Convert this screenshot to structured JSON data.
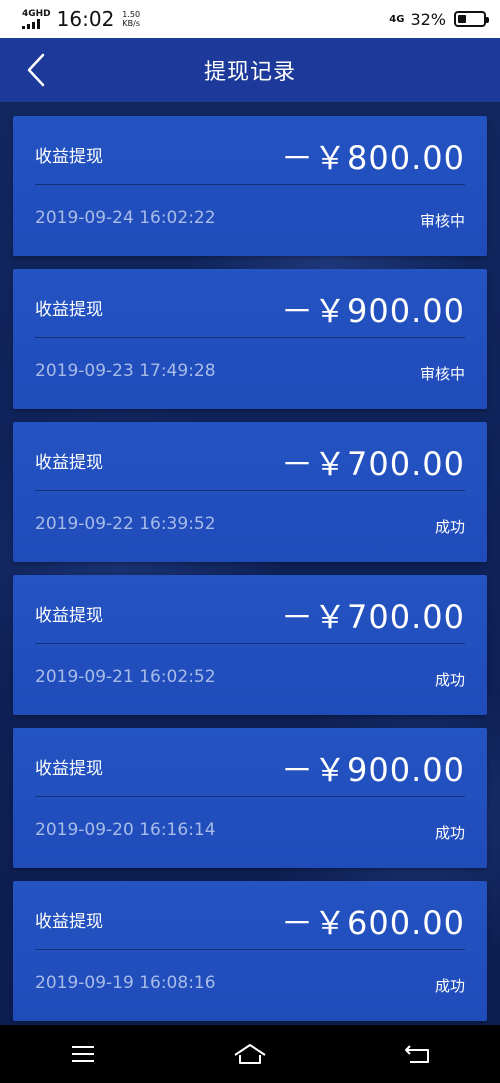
{
  "status_bar": {
    "network_label": "4GHD",
    "time": "16:02",
    "speed_value": "1.50",
    "speed_unit": "KB/s",
    "network_right": "4G",
    "battery_percent": "32%",
    "battery_level": 0.32
  },
  "header": {
    "title": "提现记录",
    "back_icon": "chevron-left-icon"
  },
  "records": [
    {
      "title": "收益提现",
      "amount": "－￥800.00",
      "datetime": "2019-09-24 16:02:22",
      "status": "审核中"
    },
    {
      "title": "收益提现",
      "amount": "－￥900.00",
      "datetime": "2019-09-23 17:49:28",
      "status": "审核中"
    },
    {
      "title": "收益提现",
      "amount": "－￥700.00",
      "datetime": "2019-09-22 16:39:52",
      "status": "成功"
    },
    {
      "title": "收益提现",
      "amount": "－￥700.00",
      "datetime": "2019-09-21 16:02:52",
      "status": "成功"
    },
    {
      "title": "收益提现",
      "amount": "－￥900.00",
      "datetime": "2019-09-20 16:16:14",
      "status": "成功"
    },
    {
      "title": "收益提现",
      "amount": "－￥600.00",
      "datetime": "2019-09-19 16:08:16",
      "status": "成功"
    }
  ],
  "nav_bar": {
    "menu_icon": "menu-icon",
    "home_icon": "home-icon",
    "back_icon": "back-arrow-icon"
  },
  "colors": {
    "header_bg": "#1d3a9a",
    "card_bg": "#2453c2",
    "date_text": "#a8bce8"
  }
}
